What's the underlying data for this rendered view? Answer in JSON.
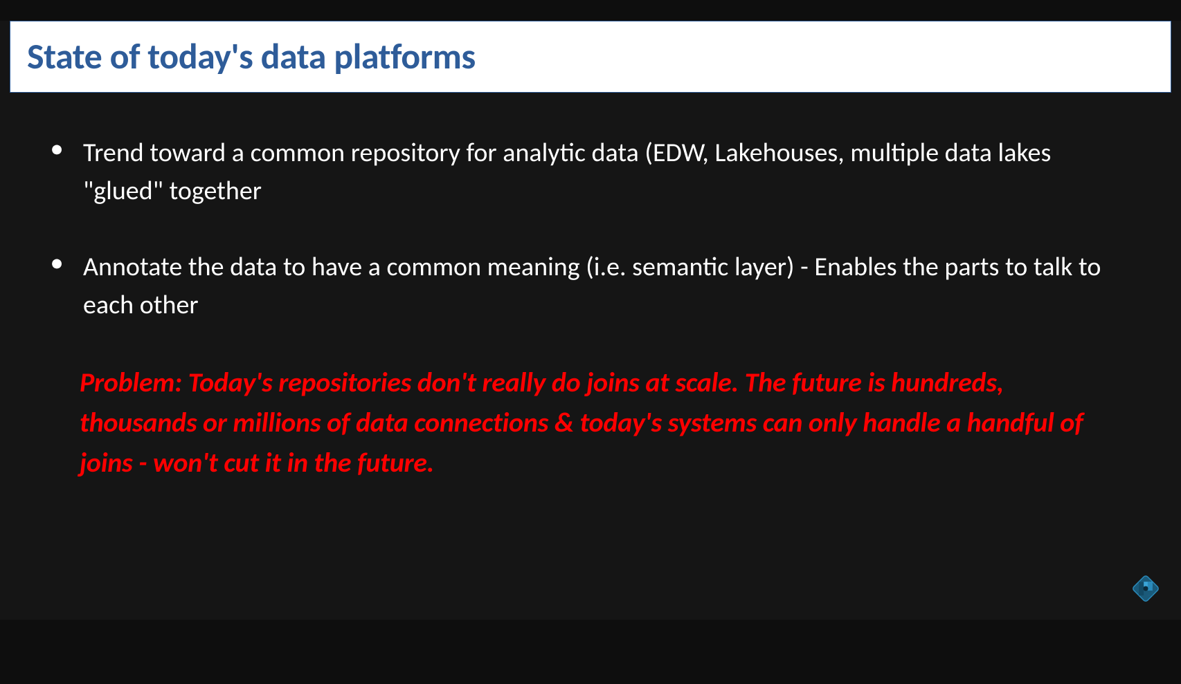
{
  "slide": {
    "title": "State of today's data platforms",
    "bullets": [
      "Trend toward a common repository for analytic data (EDW, Lakehouses, multiple data lakes \"glued\" together",
      "Annotate the data to have a common meaning (i.e. semantic layer) - Enables the parts to talk to each other"
    ],
    "problem": "Problem: Today's repositories don't really do joins at scale. The future is hundreds, thousands or millions of data connections & today's systems can only handle a handful of joins - won't cut it in the future."
  },
  "colors": {
    "background": "#151515",
    "title_text": "#2e5c99",
    "title_bg": "#ffffff",
    "body_text": "#ffffff",
    "problem_text": "#ff0000"
  }
}
